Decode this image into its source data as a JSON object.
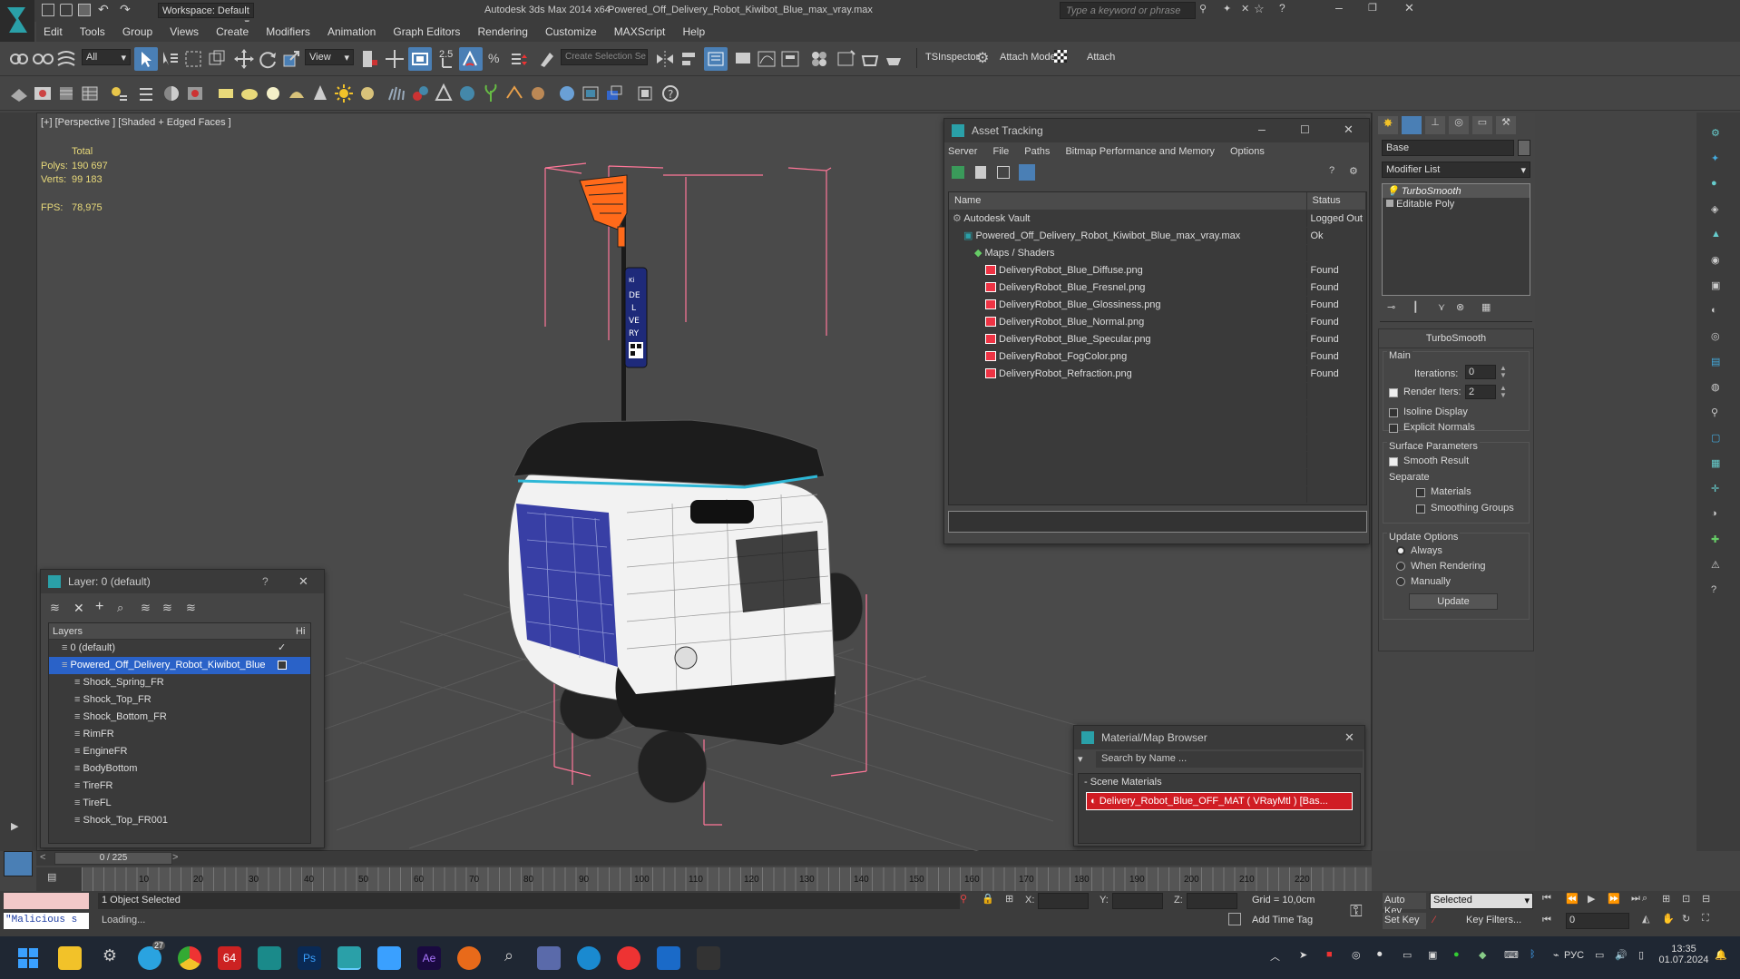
{
  "titlebar": {
    "app_title": "Autodesk 3ds Max  2014 x64",
    "file_title": "Powered_Off_Delivery_Robot_Kiwibot_Blue_max_vray.max",
    "workspace_label": "Workspace: Default",
    "search_placeholder": "Type a keyword or phrase"
  },
  "menus": [
    "Edit",
    "Tools",
    "Group",
    "Views",
    "Create",
    "Modifiers",
    "Animation",
    "Graph Editors",
    "Rendering",
    "Customize",
    "MAXScript",
    "Help"
  ],
  "toolbar": {
    "filter_value": "All",
    "refcoord_value": "View",
    "snap_value": "2.5",
    "named_sel_placeholder": "Create Selection Se",
    "tsinspector_label": "TSInspector",
    "attach_mode_label": "Attach Mode",
    "attach_label": "Attach"
  },
  "viewport": {
    "label": "[+] [Perspective ] [Shaded + Edged Faces ]",
    "stats_header": "Total",
    "polys_label": "Polys:",
    "polys_value": "190 697",
    "verts_label": "Verts:",
    "verts_value": "99 183",
    "fps_label": "FPS:",
    "fps_value": "78,975",
    "sign_text": [
      "Ki",
      "DE",
      "L",
      "VE",
      "RY"
    ]
  },
  "layer_window": {
    "title": "Layer: 0 (default)",
    "help": "?",
    "col_layers": "Layers",
    "col_hide": "Hi",
    "rows": [
      {
        "label": "0 (default)",
        "indent": 1,
        "selected": false
      },
      {
        "label": "Powered_Off_Delivery_Robot_Kiwibot_Blue",
        "indent": 1,
        "selected": true
      },
      {
        "label": "Shock_Spring_FR",
        "indent": 2,
        "selected": false
      },
      {
        "label": "Shock_Top_FR",
        "indent": 2,
        "selected": false
      },
      {
        "label": "Shock_Bottom_FR",
        "indent": 2,
        "selected": false
      },
      {
        "label": "RimFR",
        "indent": 2,
        "selected": false
      },
      {
        "label": "EngineFR",
        "indent": 2,
        "selected": false
      },
      {
        "label": "BodyBottom",
        "indent": 2,
        "selected": false
      },
      {
        "label": "TireFR",
        "indent": 2,
        "selected": false
      },
      {
        "label": "TireFL",
        "indent": 2,
        "selected": false
      },
      {
        "label": "Shock_Top_FR001",
        "indent": 2,
        "selected": false
      }
    ]
  },
  "asset_tracking": {
    "title": "Asset Tracking",
    "menus": [
      "Server",
      "File",
      "Paths",
      "Bitmap Performance and Memory",
      "Options"
    ],
    "col_name": "Name",
    "col_status": "Status",
    "rows": [
      {
        "name": "Autodesk Vault",
        "status": "Logged Out",
        "indent": 1
      },
      {
        "name": "Powered_Off_Delivery_Robot_Kiwibot_Blue_max_vray.max",
        "status": "Ok",
        "indent": 2
      },
      {
        "name": "Maps / Shaders",
        "status": "",
        "indent": 3
      },
      {
        "name": "DeliveryRobot_Blue_Diffuse.png",
        "status": "Found",
        "indent": 4
      },
      {
        "name": "DeliveryRobot_Blue_Fresnel.png",
        "status": "Found",
        "indent": 4
      },
      {
        "name": "DeliveryRobot_Blue_Glossiness.png",
        "status": "Found",
        "indent": 4
      },
      {
        "name": "DeliveryRobot_Blue_Normal.png",
        "status": "Found",
        "indent": 4
      },
      {
        "name": "DeliveryRobot_Blue_Specular.png",
        "status": "Found",
        "indent": 4
      },
      {
        "name": "DeliveryRobot_FogColor.png",
        "status": "Found",
        "indent": 4
      },
      {
        "name": "DeliveryRobot_Refraction.png",
        "status": "Found",
        "indent": 4
      }
    ]
  },
  "material_browser": {
    "title": "Material/Map Browser",
    "search_placeholder": "Search by Name ...",
    "group_label": "- Scene Materials",
    "material_item": "Delivery_Robot_Blue_OFF_MAT ( VRayMtl ) [Bas..."
  },
  "command_panel": {
    "object_name": "Base",
    "modifier_list_label": "Modifier List",
    "stack": [
      "TurboSmooth",
      "Editable Poly"
    ],
    "rollout_title": "TurboSmooth",
    "main_label": "Main",
    "iterations_label": "Iterations:",
    "iterations_value": "0",
    "render_iters_label": "Render Iters:",
    "render_iters_value": "2",
    "isoline_label": "Isoline Display",
    "explicit_normals_label": "Explicit Normals",
    "surface_params_label": "Surface Parameters",
    "smooth_result_label": "Smooth Result",
    "separate_label": "Separate",
    "materials_label": "Materials",
    "smoothing_groups_label": "Smoothing Groups",
    "update_options_label": "Update Options",
    "always_label": "Always",
    "when_rendering_label": "When Rendering",
    "manually_label": "Manually",
    "update_button": "Update"
  },
  "timeline": {
    "frame_label": "0 / 225",
    "ticks": [
      "10",
      "20",
      "30",
      "40",
      "50",
      "60",
      "70",
      "80",
      "90",
      "100",
      "110",
      "120",
      "130",
      "140",
      "150",
      "160",
      "170",
      "180",
      "190",
      "200",
      "210",
      "220"
    ]
  },
  "status": {
    "maxscript_text": "\"Malicious s",
    "selection_text": "1 Object Selected",
    "loading_text": "Loading...",
    "x_label": "X:",
    "y_label": "Y:",
    "z_label": "Z:",
    "grid_text": "Grid = 10,0cm",
    "add_time_tag": "Add Time Tag",
    "auto_key": "Auto Key",
    "set_key": "Set Key",
    "selected_value": "Selected",
    "key_filters": "Key Filters...",
    "frame_value": "0"
  },
  "taskbar": {
    "language": "РУС",
    "time": "13:35",
    "date": "01.07.2024",
    "telegram_badge": "27"
  },
  "colors": {
    "accent": "#4a7fb5",
    "selection": "#2a62c8",
    "wire": "#ff7799",
    "robot_blue": "#2d35a0",
    "orange": "#ff6a1a"
  }
}
